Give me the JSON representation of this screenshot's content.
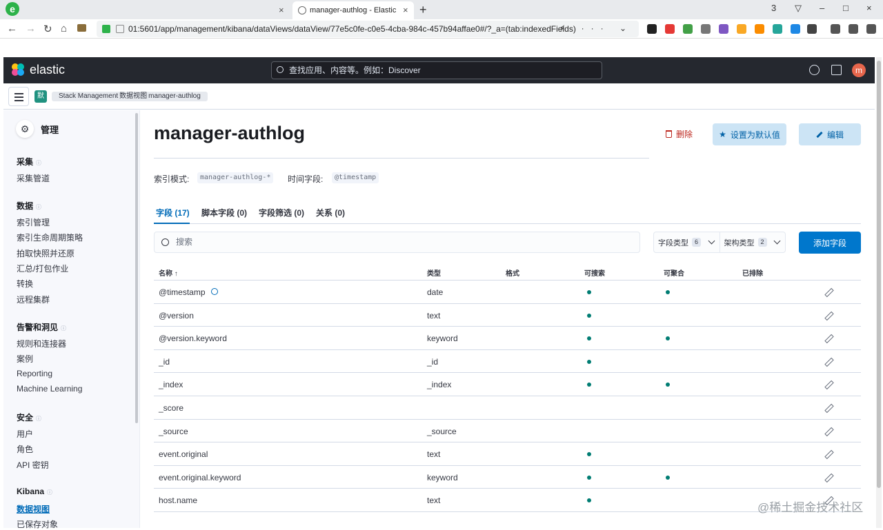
{
  "browser": {
    "logo_letter": "e",
    "active_tab_title": "manager-authlog - Elastic",
    "url": "01:5601/app/management/kibana/dataViews/dataView/77e5c0fe-c0e5-4cba-984c-457b94affae0#/?_a=(tab:indexedFields)",
    "url_tail": "⚡ ··· ⌄",
    "new_tab": "+",
    "tab_close": "×",
    "window_controls": [
      "3",
      "▽",
      "–",
      "□",
      "×"
    ],
    "nav": [
      "←",
      "→",
      "↻",
      "⌂"
    ]
  },
  "header": {
    "brand": "elastic",
    "search_placeholder": "查找应用、内容等。例如：Discover",
    "avatar_letter": "m"
  },
  "subheader": {
    "space_badge": "默",
    "breadcrumbs": [
      "Stack Management",
      "数据视图",
      "manager-authlog"
    ]
  },
  "sidebar": {
    "title": "管理",
    "sections": [
      {
        "label": "采集",
        "items": [
          "采集管道"
        ]
      },
      {
        "label": "数据",
        "items": [
          "索引管理",
          "索引生命周期策略",
          "拍取快照并还原",
          "汇总/打包作业",
          "转换",
          "远程集群"
        ]
      },
      {
        "label": "告警和洞见",
        "items": [
          "规则和连接器",
          "案例",
          "Reporting",
          "Machine Learning"
        ]
      },
      {
        "label": "安全",
        "items": [
          "用户",
          "角色",
          "API 密钥"
        ]
      },
      {
        "label": "Kibana",
        "items": [
          "数据视图",
          "已保存对象"
        ]
      }
    ],
    "info_glyph": "ⓘ"
  },
  "main": {
    "title": "manager-authlog",
    "delete_label": "删除",
    "set_default_label": "设置为默认值",
    "edit_label": "编辑",
    "index_pattern_label": "索引模式:",
    "index_pattern_value": "manager-authlog-*",
    "time_field_label": "时间字段:",
    "time_field_value": "@timestamp",
    "tabs": [
      "字段 (17)",
      "脚本字段 (0)",
      "字段筛选 (0)",
      "关系 (0)"
    ],
    "search_placeholder": "搜索",
    "filter_field_type": "字段类型",
    "filter_field_type_count": "6",
    "filter_schema_type": "架构类型",
    "filter_schema_type_count": "2",
    "add_field_label": "添加字段",
    "columns": [
      "名称 ↑",
      "类型",
      "格式",
      "可搜索",
      "可聚合",
      "已排除"
    ],
    "rows": [
      {
        "name": "@timestamp",
        "type": "date",
        "searchable": true,
        "aggregatable": true,
        "time": true
      },
      {
        "name": "@version",
        "type": "text",
        "searchable": true,
        "aggregatable": false
      },
      {
        "name": "@version.keyword",
        "type": "keyword",
        "searchable": true,
        "aggregatable": true
      },
      {
        "name": "_id",
        "type": "_id",
        "searchable": true,
        "aggregatable": false
      },
      {
        "name": "_index",
        "type": "_index",
        "searchable": true,
        "aggregatable": true
      },
      {
        "name": "_score",
        "type": "",
        "searchable": false,
        "aggregatable": false
      },
      {
        "name": "_source",
        "type": "_source",
        "searchable": false,
        "aggregatable": false
      },
      {
        "name": "event.original",
        "type": "text",
        "searchable": true,
        "aggregatable": false
      },
      {
        "name": "event.original.keyword",
        "type": "keyword",
        "searchable": true,
        "aggregatable": true
      },
      {
        "name": "host.name",
        "type": "text",
        "searchable": true,
        "aggregatable": false
      }
    ]
  },
  "watermark": "@稀土掘金技术社区",
  "colors": {
    "accent": "#0077cc",
    "header_bg": "#25282f",
    "dot": "#017d73",
    "danger": "#bd271e"
  }
}
